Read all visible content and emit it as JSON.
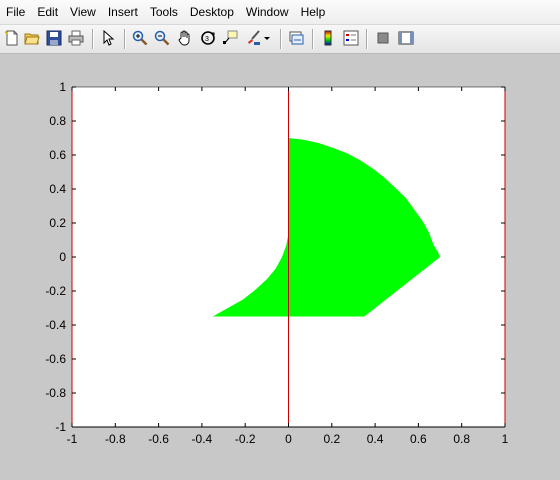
{
  "menu": [
    "File",
    "Edit",
    "View",
    "Insert",
    "Tools",
    "Desktop",
    "Window",
    "Help"
  ],
  "toolbar": {
    "buttons": [
      {
        "name": "new-figure-icon"
      },
      {
        "name": "open-file-icon"
      },
      {
        "name": "save-figure-icon"
      },
      {
        "name": "print-figure-icon"
      },
      {
        "name": "edit-plot-pointer-icon"
      },
      {
        "name": "zoom-in-icon"
      },
      {
        "name": "zoom-out-icon"
      },
      {
        "name": "pan-hand-icon"
      },
      {
        "name": "rotate-3d-icon"
      },
      {
        "name": "data-cursor-icon"
      },
      {
        "name": "brush-icon"
      },
      {
        "name": "brush-dropdown-icon"
      },
      {
        "name": "link-plot-icon"
      },
      {
        "name": "colorbar-icon"
      },
      {
        "name": "legend-icon"
      },
      {
        "name": "hide-plot-tools-icon"
      },
      {
        "name": "show-plot-tools-icon"
      }
    ]
  },
  "colors": {
    "fill": "#00ff00",
    "axis_line": "#cc0000",
    "background": "#c8c8c8"
  },
  "chart_data": {
    "type": "area",
    "title": "",
    "xlabel": "",
    "ylabel": "",
    "xlim": [
      -1,
      1
    ],
    "ylim": [
      -1,
      1
    ],
    "xticks": [
      "-1",
      "-0.8",
      "-0.6",
      "-0.4",
      "-0.2",
      "0",
      "0.2",
      "0.4",
      "0.6",
      "0.8",
      "1"
    ],
    "yticks": [
      "1",
      "0.8",
      "0.6",
      "0.4",
      "0.2",
      "0",
      "-0.2",
      "-0.4",
      "-0.6",
      "-0.8",
      "-1"
    ],
    "grid": false,
    "polygon": {
      "x": [
        0,
        0.07,
        0.14,
        0.21,
        0.27,
        0.33,
        0.39,
        0.44,
        0.49,
        0.54,
        0.58,
        0.62,
        0.65,
        0.67,
        0.69,
        0.7,
        0.35,
        -0.35,
        -0.28,
        -0.21,
        -0.15,
        -0.1,
        -0.06,
        -0.03,
        -0.01,
        0,
        0
      ],
      "y": [
        0.7,
        0.69,
        0.67,
        0.64,
        0.61,
        0.57,
        0.52,
        0.47,
        0.41,
        0.35,
        0.28,
        0.21,
        0.14,
        0.07,
        0.03,
        0,
        -0.35,
        -0.35,
        -0.3,
        -0.25,
        -0.19,
        -0.13,
        -0.07,
        0,
        0.07,
        0.14,
        0.7
      ]
    },
    "lines": [
      {
        "x": [
          0,
          0
        ],
        "y": [
          -1,
          1
        ]
      },
      {
        "x": [
          1,
          1
        ],
        "y": [
          -1,
          1
        ]
      },
      {
        "x": [
          -1,
          -1
        ],
        "y": [
          -1,
          1
        ]
      }
    ]
  }
}
